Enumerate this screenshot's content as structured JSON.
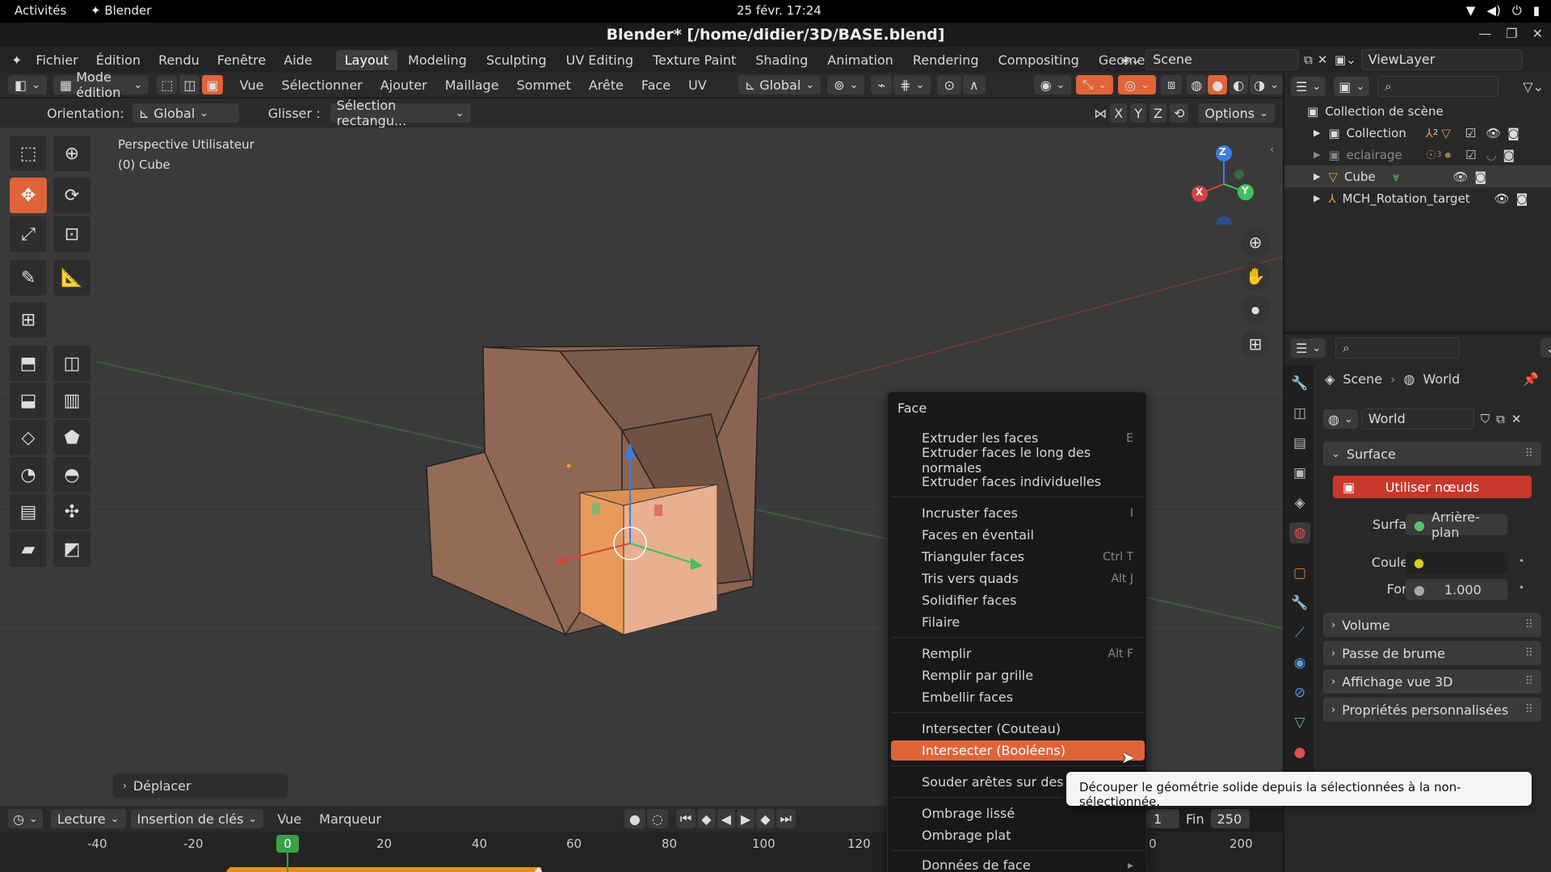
{
  "gnome": {
    "activities": "Activités",
    "app_name": "Blender",
    "clock": "25 févr.  17:24"
  },
  "window": {
    "title": "Blender* [/home/didier/3D/BASE.blend]"
  },
  "menubar": {
    "menus": [
      "Fichier",
      "Édition",
      "Rendu",
      "Fenêtre",
      "Aide"
    ],
    "workspaces": [
      "Layout",
      "Modeling",
      "Sculpting",
      "UV Editing",
      "Texture Paint",
      "Shading",
      "Animation",
      "Rendering",
      "Compositing",
      "Geometry No"
    ],
    "active_workspace": "Layout",
    "scene": "Scene",
    "view_layer": "ViewLayer"
  },
  "header": {
    "mode": "Mode édition",
    "menus": [
      "Vue",
      "Sélectionner",
      "Ajouter",
      "Maillage",
      "Sommet",
      "Arête",
      "Face",
      "UV"
    ],
    "transform_orientation": "Global",
    "orientation_label": "Orientation:",
    "orientation_value": "Global",
    "drag_label": "Glisser :",
    "drag_value": "Sélection rectangu...",
    "axes": [
      "X",
      "Y",
      "Z"
    ],
    "options": "Options"
  },
  "viewport": {
    "view_name": "Perspective Utilisateur",
    "object_name": "(0) Cube",
    "last_operator": "Déplacer",
    "gizmo_axes": [
      "X",
      "Y",
      "Z"
    ]
  },
  "context_menu": {
    "title": "Face",
    "groups": [
      [
        {
          "label": "Extruder les faces",
          "shortcut": "E"
        },
        {
          "label": "Extruder faces le long des normales",
          "shortcut": ""
        },
        {
          "label": "Extruder faces individuelles",
          "shortcut": ""
        }
      ],
      [
        {
          "label": "Incruster faces",
          "shortcut": "I"
        },
        {
          "label": "Faces en éventail",
          "shortcut": ""
        },
        {
          "label": "Trianguler faces",
          "shortcut": "Ctrl T"
        },
        {
          "label": "Tris vers quads",
          "shortcut": "Alt J"
        },
        {
          "label": "Solidifier faces",
          "shortcut": ""
        },
        {
          "label": "Filaire",
          "shortcut": ""
        }
      ],
      [
        {
          "label": "Remplir",
          "shortcut": "Alt F"
        },
        {
          "label": "Remplir par grille",
          "shortcut": ""
        },
        {
          "label": "Embellir faces",
          "shortcut": ""
        }
      ],
      [
        {
          "label": "Intersecter (Couteau)",
          "shortcut": ""
        },
        {
          "label": "Intersecter (Booléens)",
          "shortcut": "",
          "highlighted": true
        }
      ],
      [
        {
          "label": "Souder arêtes sur des fac",
          "shortcut": ""
        }
      ],
      [
        {
          "label": "Ombrage lissé",
          "shortcut": ""
        },
        {
          "label": "Ombrage plat",
          "shortcut": ""
        }
      ],
      [
        {
          "label": "Données de face",
          "shortcut": "▸"
        }
      ]
    ]
  },
  "tooltip": "Découper le géométrie solide depuis la sélectionnées à la non-sélectionnée.",
  "outliner": {
    "root": "Collection de scène",
    "items": [
      {
        "label": "Collection",
        "badge": "2"
      },
      {
        "label": "eclairage",
        "badge": "3"
      },
      {
        "label": "Cube",
        "badge": ""
      },
      {
        "label": "MCH_Rotation_target",
        "badge": ""
      }
    ]
  },
  "properties": {
    "breadcrumb": [
      "Scene",
      "World"
    ],
    "world_name": "World",
    "surface_panel": "Surface",
    "use_nodes": "Utiliser nœuds",
    "surface_label": "Surface",
    "surface_value": "Arrière-plan",
    "color_label": "Couleur",
    "strength_label": "Force",
    "strength_value": "1.000",
    "panels": [
      "Volume",
      "Passe de brume",
      "Affichage vue 3D",
      "Propriétés personnalisées"
    ]
  },
  "timeline": {
    "playback": "Lecture",
    "keying": "Insertion de clés",
    "view": "Vue",
    "marker": "Marqueur",
    "current_frame": "0",
    "start_frame": "1",
    "end_label": "Fin",
    "end_frame": "250",
    "ruler": [
      "-40",
      "-20",
      "0",
      "20",
      "40",
      "60",
      "80",
      "100",
      "120"
    ],
    "ruler_right": [
      "0",
      "200"
    ]
  },
  "colors": {
    "accent": "#e0643a",
    "menu_bg": "#181818",
    "viewport_bg": "#3a3a3a"
  }
}
